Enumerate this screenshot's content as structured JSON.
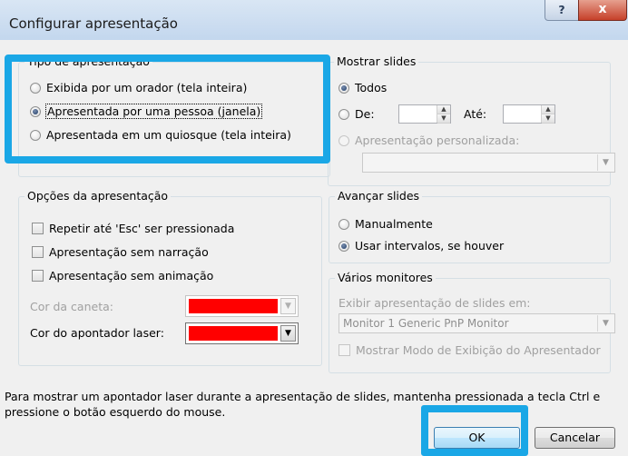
{
  "window": {
    "title": "Configurar apresentação",
    "help_label": "?",
    "close_label": "x"
  },
  "tipo": {
    "group_label": "Tipo de apresentação",
    "options": [
      {
        "label": "Exibida por um orador (tela inteira)",
        "checked": false
      },
      {
        "label": "Apresentada por uma pessoa (janela)",
        "checked": true
      },
      {
        "label": "Apresentada em um quiosque (tela inteira)",
        "checked": false
      }
    ]
  },
  "mostrar": {
    "group_label": "Mostrar slides",
    "todos": "Todos",
    "de": "De:",
    "ate": "Até:",
    "personalizada": "Apresentação personalizada:",
    "de_value": "",
    "ate_value": "",
    "personalizada_value": ""
  },
  "opcoes": {
    "group_label": "Opções da apresentação",
    "checks": [
      {
        "label": "Repetir até 'Esc' ser pressionada",
        "checked": false
      },
      {
        "label": "Apresentação sem narração",
        "checked": false
      },
      {
        "label": "Apresentação sem animação",
        "checked": false
      }
    ],
    "cor_caneta": "Cor da caneta:",
    "cor_laser": "Cor do apontador laser:",
    "pen_color": "#ff0000",
    "laser_color": "#ff0000"
  },
  "avancar": {
    "group_label": "Avançar slides",
    "manual": "Manualmente",
    "intervalos": "Usar intervalos, se houver"
  },
  "monitores": {
    "group_label": "Vários monitores",
    "exibir": "Exibir apresentação de slides em:",
    "monitor_value": "Monitor 1 Generic PnP Monitor",
    "modo_apresentador": "Mostrar Modo de Exibição do Apresentador"
  },
  "footer": {
    "hint": "Para mostrar um apontador laser durante a apresentação de slides, mantenha pressionada a tecla Ctrl e pressione o botão esquerdo do mouse.",
    "ok": "OK",
    "cancel": "Cancelar"
  },
  "colors": {
    "highlight": "#1aa7e6",
    "title_bar": "#c3d7ee",
    "close_button": "#c6402a"
  }
}
